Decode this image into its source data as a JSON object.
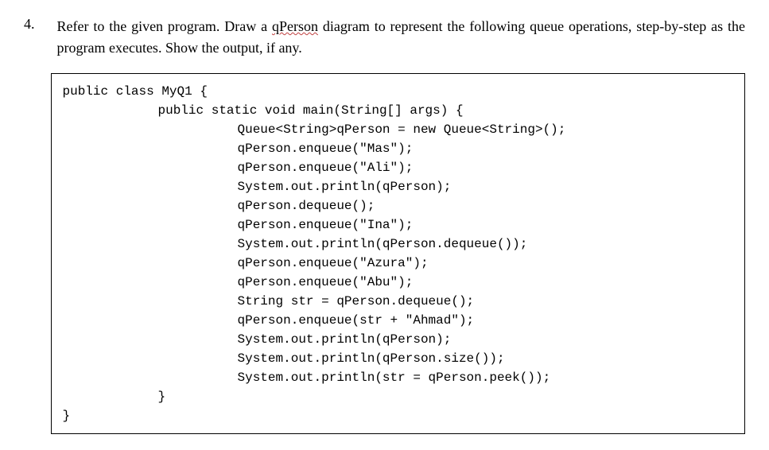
{
  "question": {
    "number": "4.",
    "text_before": "Refer to the given program. Draw a ",
    "underlined_word": "qPerson",
    "text_after": " diagram to represent the following queue operations, step-by-step as the program executes. Show the output, if any."
  },
  "code": {
    "line1": "public class MyQ1 {",
    "blank": "",
    "line2": "public static void main(String[] args) {",
    "line3": "Queue<String>qPerson = new Queue<String>();",
    "line4": "qPerson.enqueue(\"Mas\");",
    "line5": "qPerson.enqueue(\"Ali\");",
    "line6": "System.out.println(qPerson);",
    "line7": "qPerson.dequeue();",
    "line8": "qPerson.enqueue(\"Ina\");",
    "line9": "System.out.println(qPerson.dequeue());",
    "line10": "qPerson.enqueue(\"Azura\");",
    "line11": "qPerson.enqueue(\"Abu\");",
    "line12": "String str = qPerson.dequeue();",
    "line13": "qPerson.enqueue(str + \"Ahmad\");",
    "line14": "System.out.println(qPerson);",
    "line15": "System.out.println(qPerson.size());",
    "line16": "System.out.println(str = qPerson.peek());",
    "line17": "}",
    "line18": "}"
  }
}
